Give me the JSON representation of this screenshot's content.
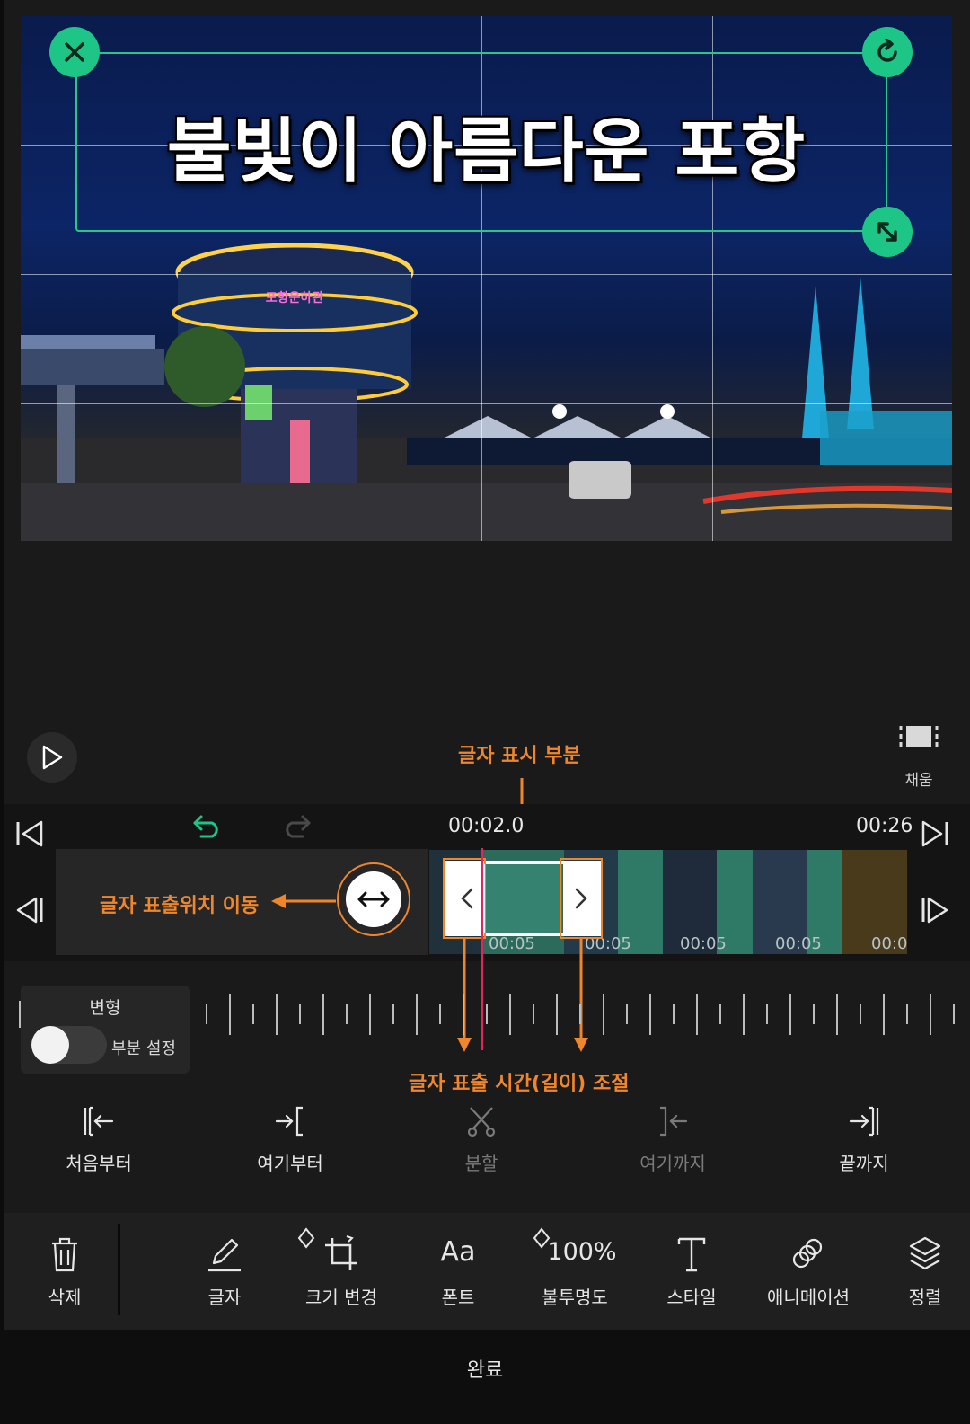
{
  "preview": {
    "title_text": "불빛이 아름다운 포항",
    "building_sign": "포항운하관",
    "close_icon": "close-icon",
    "rotate_icon": "rotate-icon",
    "resize_icon": "resize-icon"
  },
  "controls": {
    "play_icon": "play-icon",
    "fill_label": "채움"
  },
  "annotations": {
    "text_display": "글자 표시 부분",
    "move_position": "글자 표출위치 이동",
    "adjust_length": "글자 표출 시간(길이) 조절"
  },
  "timeline": {
    "current_time": "00:02.0",
    "total_time": "00:26",
    "clip_stamps": [
      "00:05",
      "00:05",
      "00:05",
      "00:05",
      "00:0"
    ]
  },
  "transform": {
    "title": "변형",
    "toggle_label": "부분 설정",
    "toggle_on": false
  },
  "trim": {
    "from_start": "처음부터",
    "from_here": "여기부터",
    "split": "분할",
    "to_here": "여기까지",
    "to_end": "끝까지"
  },
  "toolbar": {
    "delete": "삭제",
    "text": "글자",
    "resize": "크기 변경",
    "font": "폰트",
    "font_glyph": "Aa",
    "opacity": "불투명도",
    "opacity_value": "100%",
    "style": "스타일",
    "animation": "애니메이션",
    "arrange": "정렬"
  },
  "done": "완료",
  "colors": {
    "accent_green": "#1dc587",
    "annotation_orange": "#f0862c",
    "playhead": "#e5245a"
  }
}
